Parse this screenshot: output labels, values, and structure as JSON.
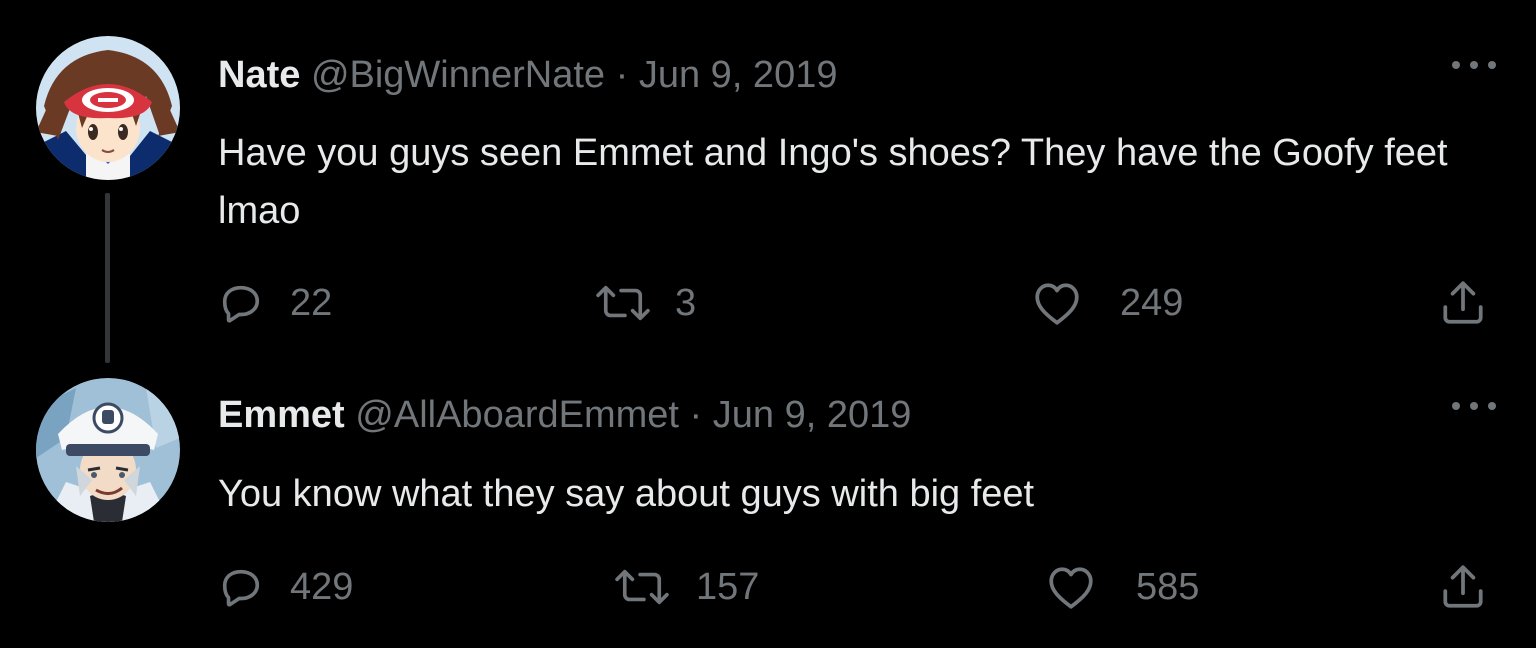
{
  "tweets": [
    {
      "display_name": "Nate",
      "handle": "@BigWinnerNate",
      "separator": "·",
      "date": "Jun 9, 2019",
      "text": "Have you guys seen Emmet and Ingo's shoes? They have the Goofy feet lmao",
      "avatar_icon": "trainer-avatar-red-cap",
      "replies": "22",
      "retweets": "3",
      "likes": "249"
    },
    {
      "display_name": "Emmet",
      "handle": "@AllAboardEmmet",
      "separator": "·",
      "date": "Jun 9, 2019",
      "text": "You know what they say about guys with big feet",
      "avatar_icon": "conductor-avatar-white-cap",
      "replies": "429",
      "retweets": "157",
      "likes": "585"
    }
  ],
  "colors": {
    "background": "#000000",
    "primary_text": "#e7e9ea",
    "secondary_text": "#71767b",
    "thread_line": "#333639"
  },
  "icons": [
    "reply-icon",
    "retweet-icon",
    "like-icon",
    "share-icon",
    "more-options-icon"
  ]
}
